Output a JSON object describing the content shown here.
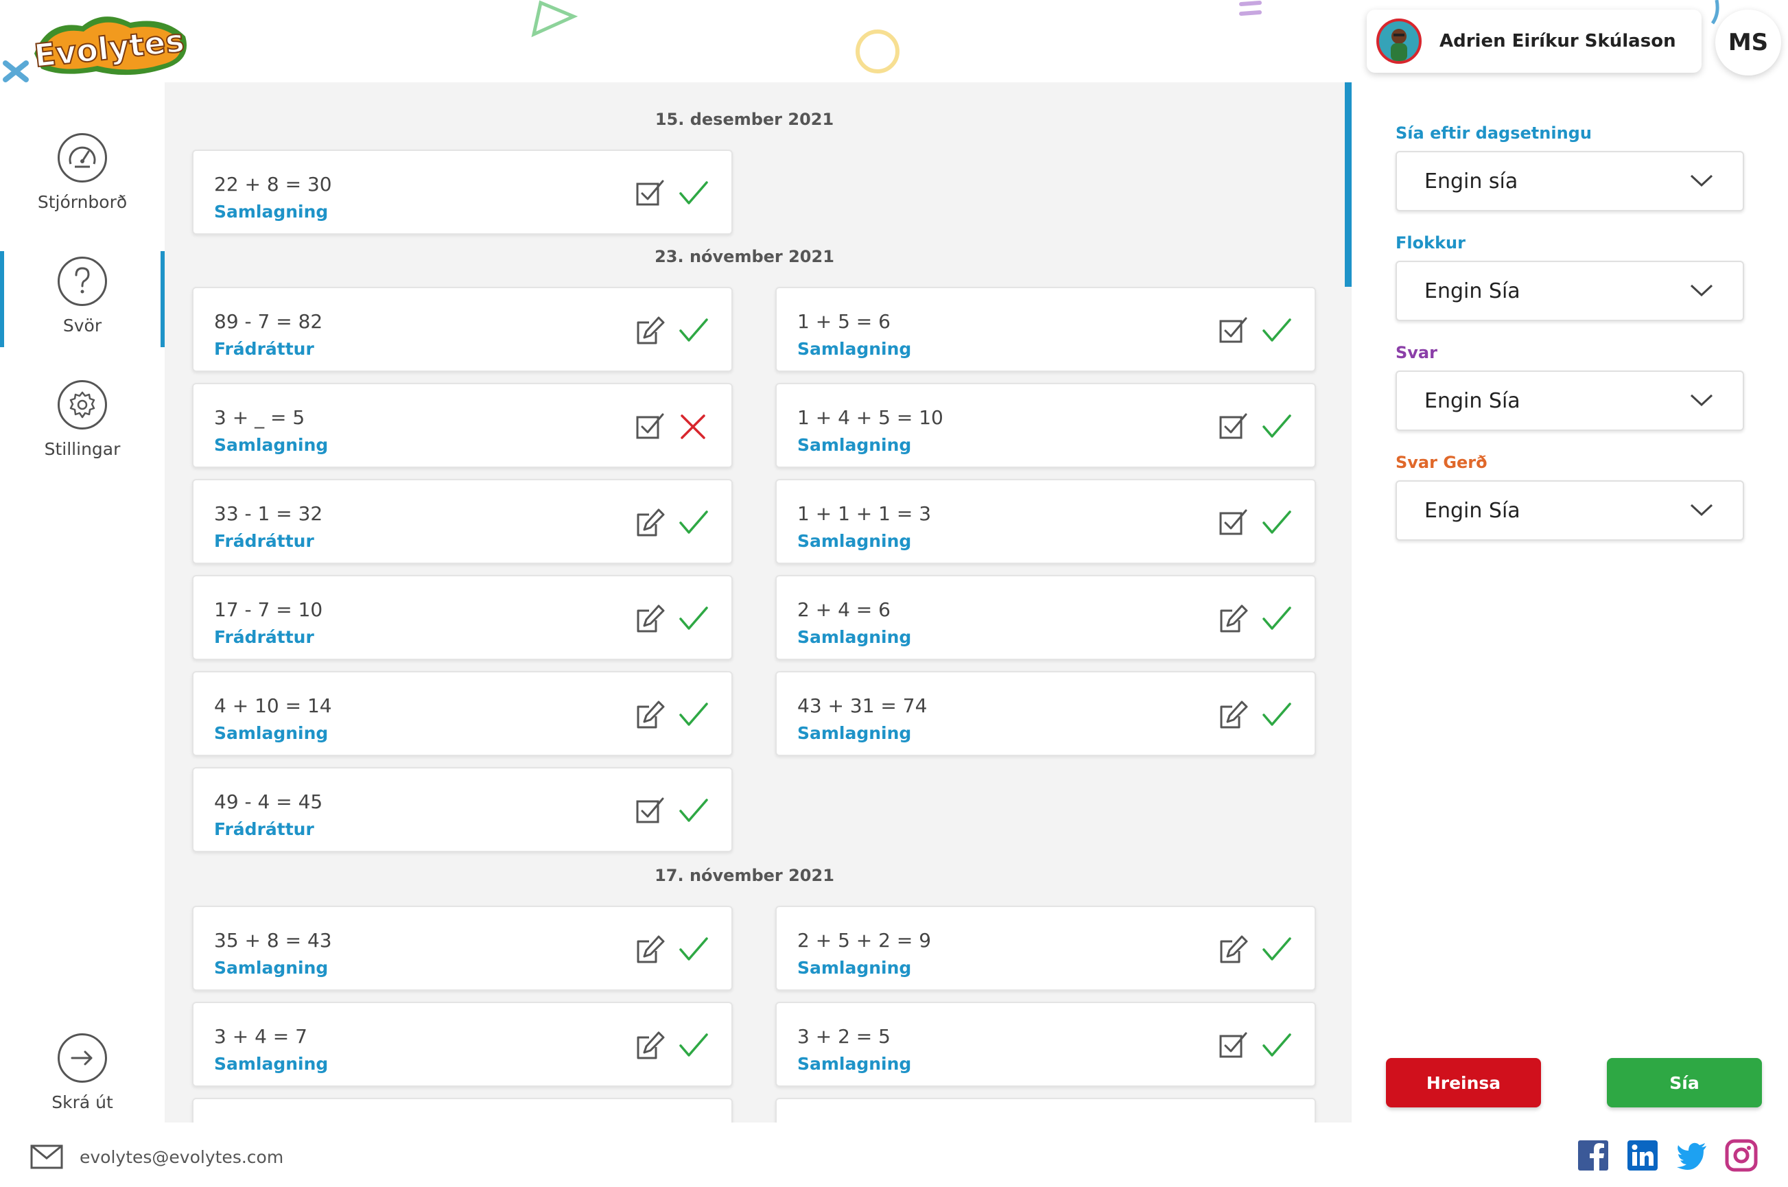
{
  "header": {
    "logo_text": "Evolytes",
    "user_name": "Adrien Eiríkur Skúlason",
    "user_initials": "MS"
  },
  "sidebar": {
    "items": [
      {
        "label": "Stjórnborð",
        "icon": "speedometer-icon"
      },
      {
        "label": "Svör",
        "icon": "question-icon",
        "active": true
      },
      {
        "label": "Stillingar",
        "icon": "gear-icon"
      }
    ],
    "logout_label": "Skrá út"
  },
  "answers": {
    "groups": [
      {
        "date": "15. desember 2021",
        "items": [
          {
            "equation": "22 + 8 = 30",
            "category": "Samlagning",
            "type": "checkbox",
            "correct": true
          }
        ]
      },
      {
        "date": "23. nóvember 2021",
        "items": [
          {
            "equation": "89 - 7 = 82",
            "category": "Frádráttur",
            "type": "edit",
            "correct": true
          },
          {
            "equation": "1 + 5 = 6",
            "category": "Samlagning",
            "type": "checkbox",
            "correct": true
          },
          {
            "equation": "3 + _ = 5",
            "category": "Samlagning",
            "type": "checkbox",
            "correct": false
          },
          {
            "equation": "1 + 4 + 5 = 10",
            "category": "Samlagning",
            "type": "checkbox",
            "correct": true
          },
          {
            "equation": "33 - 1 = 32",
            "category": "Frádráttur",
            "type": "edit",
            "correct": true
          },
          {
            "equation": "1 + 1 + 1 = 3",
            "category": "Samlagning",
            "type": "checkbox",
            "correct": true
          },
          {
            "equation": "17 - 7 = 10",
            "category": "Frádráttur",
            "type": "edit",
            "correct": true
          },
          {
            "equation": "2 + 4 = 6",
            "category": "Samlagning",
            "type": "edit",
            "correct": true
          },
          {
            "equation": "4 + 10 = 14",
            "category": "Samlagning",
            "type": "edit",
            "correct": true
          },
          {
            "equation": "43 + 31 = 74",
            "category": "Samlagning",
            "type": "edit",
            "correct": true
          },
          {
            "equation": "49 - 4 = 45",
            "category": "Frádráttur",
            "type": "checkbox",
            "correct": true
          }
        ]
      },
      {
        "date": "17. nóvember 2021",
        "items": [
          {
            "equation": "35 + 8 = 43",
            "category": "Samlagning",
            "type": "edit",
            "correct": true
          },
          {
            "equation": "2 + 5 + 2 = 9",
            "category": "Samlagning",
            "type": "edit",
            "correct": true
          },
          {
            "equation": "3 + 4 = 7",
            "category": "Samlagning",
            "type": "edit",
            "correct": true
          },
          {
            "equation": "3 + 2 = 5",
            "category": "Samlagning",
            "type": "checkbox",
            "correct": true
          }
        ]
      }
    ]
  },
  "filters": [
    {
      "label": "Sía eftir dagsetningu",
      "value": "Engin sía",
      "color": "#1e93c8"
    },
    {
      "label": "Flokkur",
      "value": "Engin Sía",
      "color": "#1e93c8"
    },
    {
      "label": "Svar",
      "value": "Engin Sía",
      "color": "#8b3fa8"
    },
    {
      "label": "Svar Gerð",
      "value": "Engin Sía",
      "color": "#e0682a"
    }
  ],
  "buttons": {
    "clear_label": "Hreinsa",
    "filter_label": "Sía"
  },
  "footer": {
    "email": "evolytes@evolytes.com",
    "social": [
      "facebook-icon",
      "linkedin-icon",
      "twitter-icon",
      "instagram-icon"
    ]
  },
  "colors": {
    "accent": "#1e93c8",
    "correct": "#2ea844",
    "wrong": "#d8262d",
    "clear_button": "#d0101c",
    "filter_button": "#2ea844"
  }
}
